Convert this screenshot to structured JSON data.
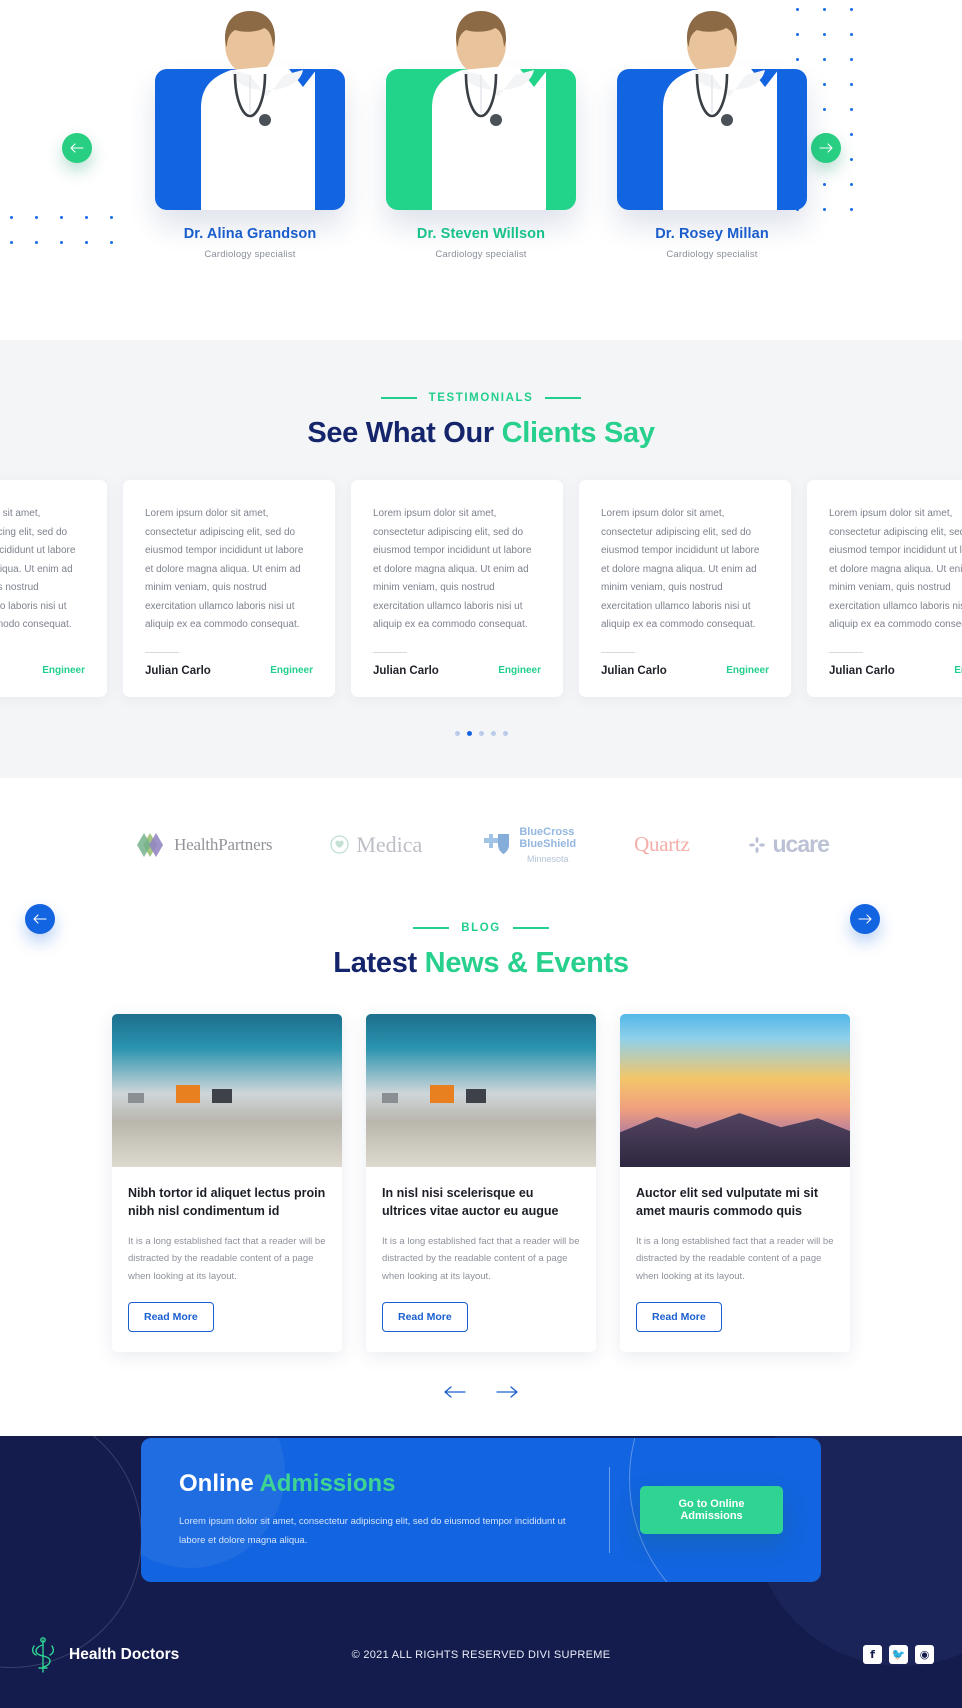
{
  "doctors": {
    "nav": {
      "prev_icon": "arrow-left",
      "next_icon": "arrow-right"
    },
    "items": [
      {
        "name": "Dr. Alina Grandson",
        "role": "Cardiology specialist",
        "bg": "blue"
      },
      {
        "name": "Dr. Steven Willson",
        "role": "Cardiology specialist",
        "bg": "green"
      },
      {
        "name": "Dr. Rosey Millan",
        "role": "Cardiology specialist",
        "bg": "blue"
      }
    ]
  },
  "testimonials": {
    "eyebrow": "TESTIMONIALS",
    "title_main": "See What Our ",
    "title_accent": "Clients Say",
    "body": "Lorem ipsum dolor sit amet, consectetur adipiscing elit, sed do eiusmod tempor incididunt ut labore et dolore magna aliqua. Ut enim ad minim veniam, quis nostrud exercitation ullamco laboris nisi ut aliquip ex ea commodo consequat.",
    "author": "Julian Carlo",
    "role": "Engineer",
    "dots": 5,
    "active_dot": 1
  },
  "partners": [
    {
      "name": "HealthPartners",
      "kind": "healthpartners"
    },
    {
      "name": "Medica",
      "kind": "medica"
    },
    {
      "name": "BlueCross BlueShield",
      "line1": "BlueCross",
      "line2": "BlueShield",
      "sub": "Minnesota",
      "kind": "bcbs"
    },
    {
      "name": "Quartz",
      "kind": "quartz"
    },
    {
      "name": "ucare",
      "kind": "ucare"
    }
  ],
  "blog": {
    "eyebrow": "BLOG",
    "title_main": "Latest ",
    "title_accent": "News & Events",
    "read_more": "Read More",
    "excerpt": "It is a long established fact that a reader will be distracted by the readable content of a page when looking at its layout.",
    "posts": [
      {
        "title": "Nibh tortor id aliquet lectus proin nibh nisl condimentum id",
        "image": "mountain-village"
      },
      {
        "title": "In nisl nisi scelerisque eu ultrices vitae auctor eu augue",
        "image": "mountain-village"
      },
      {
        "title": "Auctor elit sed vulputate mi sit amet mauris commodo quis",
        "image": "sunset-mountains"
      }
    ],
    "nav": {
      "prev_icon": "arrow-left",
      "next_icon": "arrow-right"
    }
  },
  "cta": {
    "title_main": "Online ",
    "title_accent": "Admissions",
    "subtitle": "Lorem ipsum dolor sit amet, consectetur adipiscing elit, sed do eiusmod tempor incididunt ut labore et dolore magna aliqua.",
    "button": "Go to Online Admissions"
  },
  "footer": {
    "brand": "Health Doctors",
    "copyright": "© 2021 ALL RIGHTS RESERVED DIVI SUPREME",
    "social": [
      {
        "name": "facebook",
        "glyph": "f"
      },
      {
        "name": "twitter",
        "glyph": "🐦"
      },
      {
        "name": "instagram",
        "glyph": "◉"
      }
    ]
  },
  "colors": {
    "blue": "#1364e0",
    "green": "#27d08d",
    "navy": "#141c4d",
    "dark_navy_text": "#15256b"
  }
}
